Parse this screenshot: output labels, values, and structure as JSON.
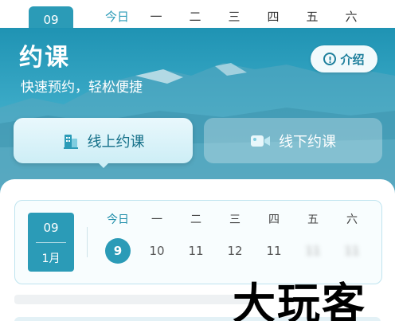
{
  "top_strip": {
    "month": "09",
    "weekdays": [
      "今日",
      "一",
      "二",
      "三",
      "四",
      "五",
      "六"
    ]
  },
  "hero": {
    "title": "约课",
    "subtitle": "快速预约，轻松便捷",
    "intro_button": "介绍",
    "info_icon_glyph": "!"
  },
  "tabs": {
    "online": "线上约课",
    "offline": "线下约课"
  },
  "calendar": {
    "month_number": "09",
    "month_label": "1月",
    "days": [
      {
        "weekday": "今日",
        "date": "9"
      },
      {
        "weekday": "一",
        "date": "10"
      },
      {
        "weekday": "二",
        "date": "11"
      },
      {
        "weekday": "三",
        "date": "12"
      },
      {
        "weekday": "四",
        "date": "11"
      },
      {
        "weekday": "五",
        "date": "11"
      },
      {
        "weekday": "六",
        "date": "11"
      }
    ]
  },
  "watermark": "大玩客",
  "colors": {
    "accent": "#2b9bb7",
    "hero_top": "#1f93b3",
    "tab_text": "#136f88"
  },
  "icons": [
    "info-icon",
    "building-icon",
    "video-camera-icon"
  ]
}
